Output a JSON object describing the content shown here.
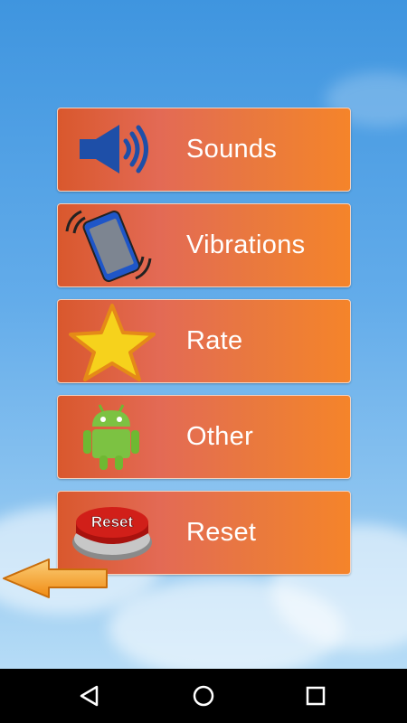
{
  "menu": {
    "items": [
      {
        "id": "sounds",
        "label": "Sounds",
        "icon": "speaker-icon"
      },
      {
        "id": "vibrations",
        "label": "Vibrations",
        "icon": "vibrating-phone-icon"
      },
      {
        "id": "rate",
        "label": "Rate",
        "icon": "star-icon"
      },
      {
        "id": "other",
        "label": "Other",
        "icon": "android-robot-icon"
      },
      {
        "id": "reset",
        "label": "Reset",
        "icon": "reset-button-icon"
      }
    ],
    "reset_icon_text": "Reset"
  },
  "nav": {
    "back": "back-icon",
    "home": "home-icon",
    "recents": "recents-icon"
  },
  "colors": {
    "button_left": "#d9582d",
    "button_right": "#f5842a",
    "sky_top": "#3f95df",
    "arrow": "#f5a623"
  }
}
